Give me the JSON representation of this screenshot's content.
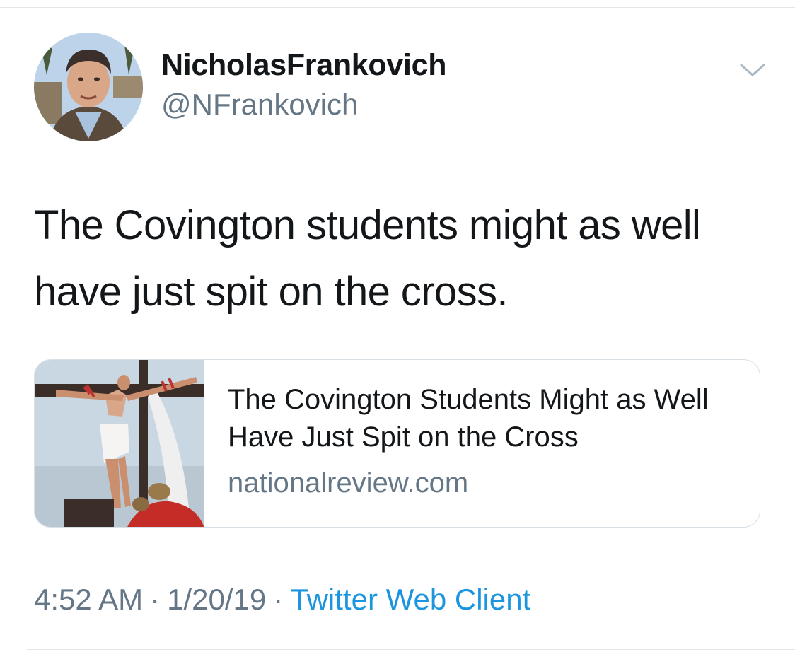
{
  "tweet": {
    "author": {
      "display_name": "NicholasFrankovich",
      "handle": "@NFrankovich"
    },
    "text": "The Covington students might as well have just spit on the cross.",
    "menu_icon": "chevron-down-icon",
    "card": {
      "title": "The Covington Students Might as Well Have Just Spit on the Cross",
      "domain": "nationalreview.com"
    },
    "meta": {
      "time": "4:52 AM",
      "separator": "·",
      "date": "1/20/19",
      "client": "Twitter Web Client"
    }
  },
  "colors": {
    "text": "#14171a",
    "secondary": "#657786",
    "link": "#1b95e0",
    "border": "#d8dfe5"
  }
}
